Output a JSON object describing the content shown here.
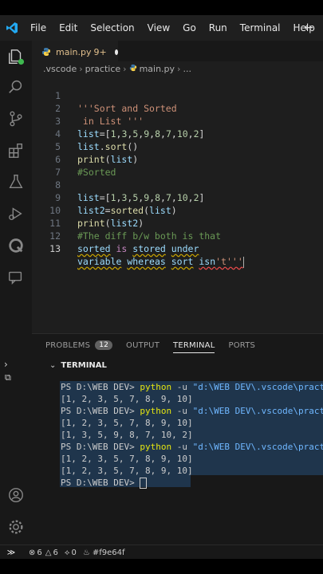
{
  "menu": [
    "File",
    "Edit",
    "Selection",
    "View",
    "Go",
    "Run",
    "Terminal",
    "Help"
  ],
  "tab": {
    "filename": "main.py",
    "problems": "9+"
  },
  "breadcrumb": [
    ".vscode",
    "practice",
    "main.py",
    "..."
  ],
  "editor": {
    "line_numbers": [
      "1",
      "2",
      "3",
      "4",
      "5",
      "6",
      "7",
      "8",
      "9",
      "10",
      "11",
      "12",
      "13"
    ],
    "lines": [
      "'''Sort and Sorted",
      " in List '''",
      "list=[1,3,5,9,8,7,10,2]",
      "list.sort()",
      "print(list)",
      "#Sorted",
      "",
      "list=[1,3,5,9,8,7,10,2]",
      "list2=sorted(list)",
      "print(list2)",
      "#The diff b/w both is that",
      "sorted is stored under",
      "variable whereas sort isn't'''"
    ]
  },
  "panel": {
    "tabs": [
      "PROBLEMS",
      "OUTPUT",
      "TERMINAL",
      "PORTS"
    ],
    "problems_count": "12",
    "terminal_label": "TERMINAL",
    "prompt": "PS D:\\WEB DEV>",
    "cmd": "python",
    "flag": "-u",
    "path": "\"d:\\WEB DEV\\.vscode\\practice\\m",
    "output": [
      "[1, 2, 3, 5, 7, 8, 9, 10]",
      "[1, 2, 3, 5, 7, 8, 9, 10]",
      "[1, 3, 5, 9, 8, 7, 10, 2]",
      "[1, 2, 3, 5, 7, 8, 9, 10]",
      "[1, 2, 3, 5, 7, 8, 9, 10]"
    ]
  },
  "status": {
    "errors": "6",
    "warnings": "6",
    "ports": "0",
    "color": "#f9e64f"
  }
}
